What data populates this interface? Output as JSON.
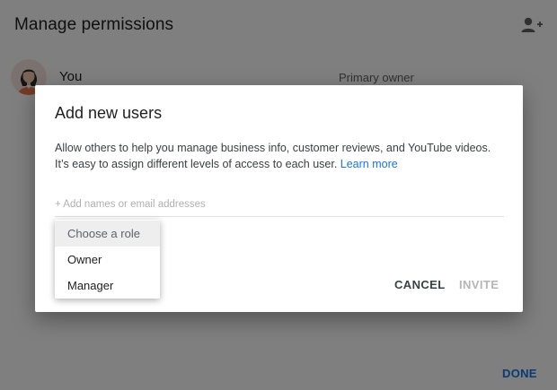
{
  "background": {
    "title": "Manage permissions",
    "users": [
      {
        "name": "You",
        "role": "Primary owner"
      }
    ],
    "done_label": "DONE",
    "add_user_icon": "person-add-icon"
  },
  "dialog": {
    "title": "Add new users",
    "description": "Allow others to help you manage business info, customer reviews, and YouTube videos. It’s easy to assign different levels of access to each user.",
    "learn_more": "Learn more",
    "input_placeholder": "+ Add names or email addresses",
    "input_value": "",
    "cancel_label": "CANCEL",
    "invite_label": "INVITE"
  },
  "role_menu": {
    "header": "Choose a role",
    "options": [
      "Owner",
      "Manager"
    ]
  },
  "colors": {
    "accent": "#1a73e8",
    "scrim": "rgba(0,0,0,0.5)",
    "disabled_text": "#b6b6b6"
  }
}
